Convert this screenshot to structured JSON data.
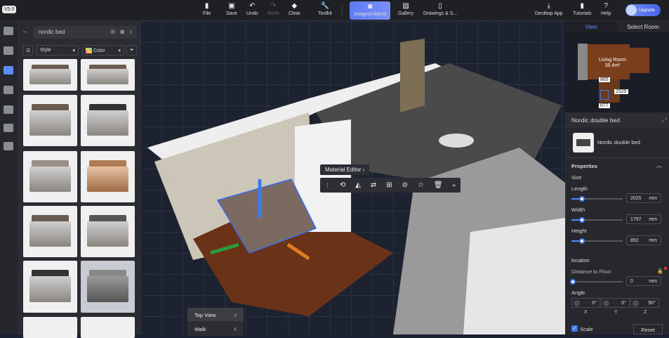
{
  "version": "V5.0",
  "toolbar": {
    "file": "File",
    "save": "Save",
    "undo": "Undo",
    "redo": "Redo",
    "clear": "Clear",
    "toolkit": "Toolkit",
    "images_videos": "Images/Videos",
    "gallery": "Gallery",
    "drawings": "Drawings & S...",
    "desktop_app": "Desktop App",
    "tutorials": "Tutorials",
    "help": "Help",
    "upgrade": "Upgrade"
  },
  "catalog": {
    "search_value": "nordic bed",
    "style_label": "Style",
    "color_label": "Color"
  },
  "minimap": {
    "tab_view": "View",
    "tab_select_room": "Select Room",
    "room_name": "Living Room",
    "room_area": "35.4m²",
    "dim1": "865",
    "dim2": "1529",
    "dim3": "677"
  },
  "context": {
    "material_editor": "Material Editor"
  },
  "view_menu": [
    {
      "label": "Top View",
      "key": "3"
    },
    {
      "label": "Walk",
      "key": "4"
    }
  ],
  "props": {
    "title": "Nordic double bed",
    "item_name": "Nordic double bed",
    "section": "Properties",
    "size": "Size",
    "length_label": "Length",
    "length": "2025",
    "width_label": "Width",
    "width": "1797",
    "height_label": "Height",
    "height": "892",
    "unit": "mm",
    "location": "location",
    "floor_label": "Distance to Floor",
    "floor": "0",
    "angle": "Angle",
    "ax": "0°",
    "ay": "0°",
    "az": "90°",
    "x": "X",
    "y": "Y",
    "z": "Z",
    "scale": "Scale",
    "reset": "Reset"
  },
  "colors": {
    "accent": "#4a8cff",
    "active": "#6b84f7"
  }
}
